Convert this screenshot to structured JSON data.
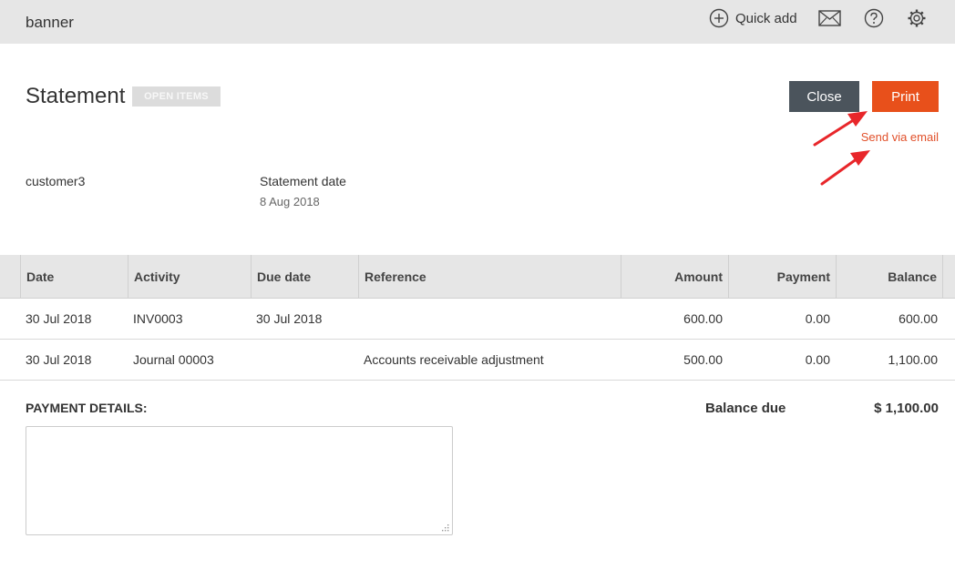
{
  "header": {
    "banner": "banner",
    "quick_add_label": "Quick add",
    "icons": [
      "plus-circle-icon",
      "mail-icon",
      "help-icon",
      "gear-icon"
    ]
  },
  "statement": {
    "title": "Statement",
    "badge": "OPEN ITEMS",
    "close_label": "Close",
    "print_label": "Print",
    "send_email_label": "Send via email",
    "customer": "customer3",
    "date_label": "Statement date",
    "date_value": "8 Aug 2018"
  },
  "table": {
    "columns": [
      "Date",
      "Activity",
      "Due date",
      "Reference",
      "Amount",
      "Payment",
      "Balance"
    ],
    "rows": [
      [
        "30 Jul 2018",
        "INV0003",
        "30 Jul 2018",
        "",
        "600.00",
        "0.00",
        "600.00"
      ],
      [
        "30 Jul 2018",
        "Journal 00003",
        "",
        "Accounts receivable adjustment",
        "500.00",
        "0.00",
        "1,100.00"
      ]
    ]
  },
  "footer": {
    "payment_details_label": "PAYMENT DETAILS:",
    "payment_details_value": "",
    "balance_due_label": "Balance due",
    "balance_due_value": "$ 1,100.00"
  },
  "colors": {
    "topbar": "#e6e6e6",
    "close_button": "#4b545c",
    "print_button": "#e8501b",
    "link": "#e1502a",
    "annotation_arrow": "#e8262a"
  }
}
